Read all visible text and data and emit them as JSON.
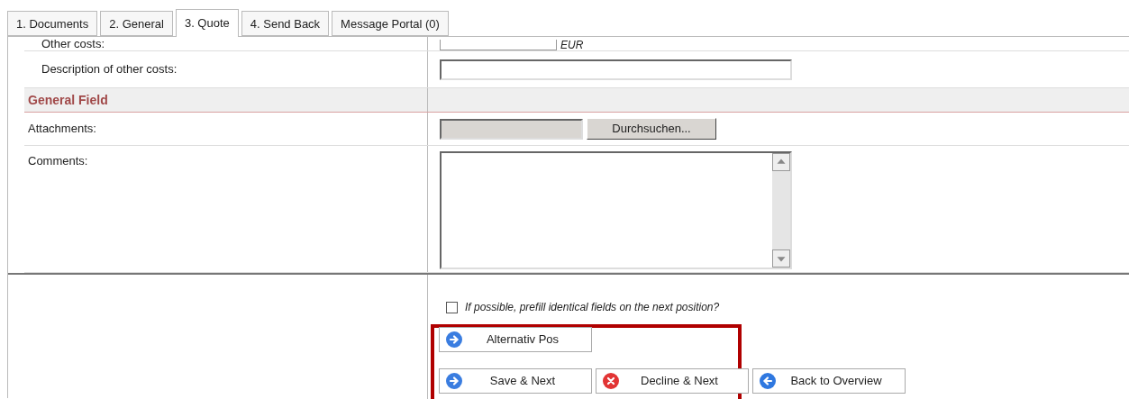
{
  "tabs": [
    {
      "label": "1. Documents",
      "selected": false
    },
    {
      "label": "2. General",
      "selected": false
    },
    {
      "label": "3. Quote",
      "selected": true
    },
    {
      "label": "4. Send Back",
      "selected": false
    },
    {
      "label": "Message Portal (0)",
      "selected": false
    }
  ],
  "rows": [
    {
      "kind": "currency",
      "label": "Other costs:",
      "unit": "EUR"
    },
    {
      "kind": "text",
      "label": "Description of other costs:"
    },
    {
      "kind": "section",
      "label": "General Field"
    },
    {
      "kind": "file",
      "label": "Attachments:",
      "button": "Durchsuchen..."
    },
    {
      "kind": "textarea",
      "label": "Comments:"
    }
  ],
  "prefill": {
    "label": "If possible, prefill identical fields on the next position?",
    "checked": false
  },
  "buttons": [
    [
      {
        "label": "Alternativ Pos",
        "kind": "forward"
      }
    ],
    [
      {
        "label": "Save & Next",
        "kind": "forward"
      },
      {
        "label": "Decline & Next",
        "kind": "decline"
      },
      {
        "label": "Back to Overview",
        "kind": "back"
      }
    ]
  ]
}
